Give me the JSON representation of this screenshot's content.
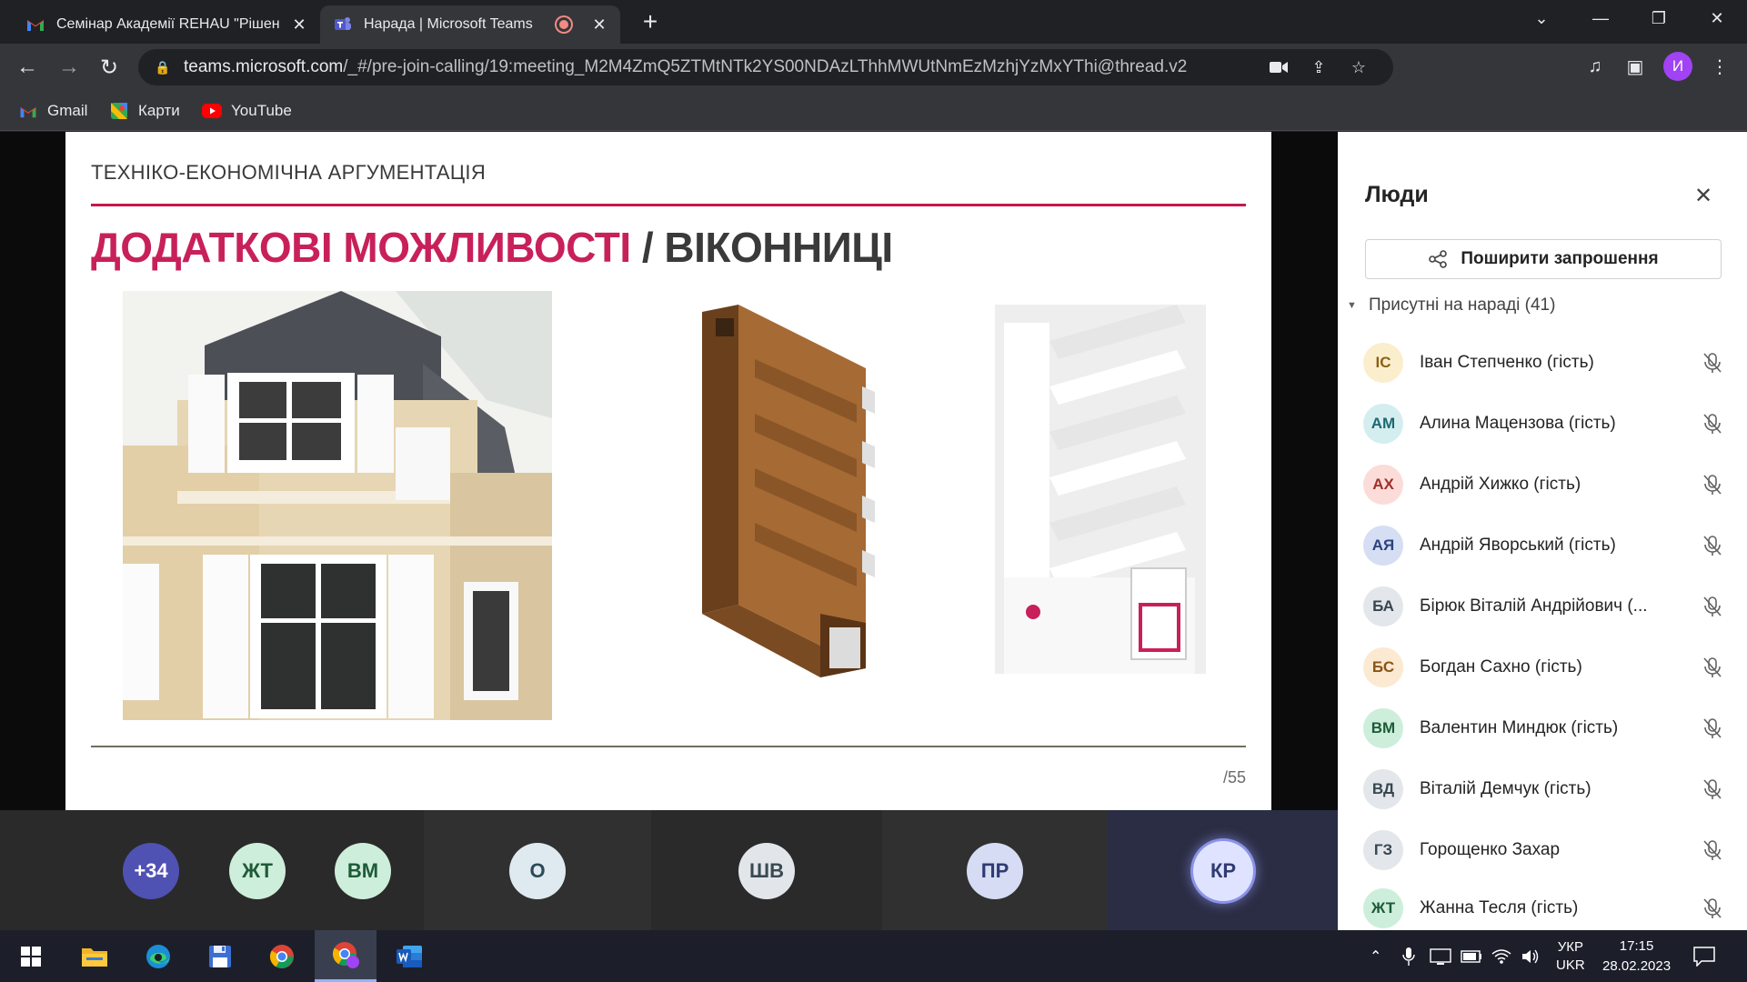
{
  "browser": {
    "tabs": [
      {
        "title": "Семінар Академії REHAU \"Рішен",
        "active": false,
        "icon": "gmail-icon"
      },
      {
        "title": "Нарада | Microsoft Teams",
        "active": true,
        "icon": "teams-icon",
        "recording": true
      }
    ],
    "address": {
      "host": "teams.microsoft.com",
      "path": "/_#/pre-join-calling/19:meeting_M2M4ZmQ5ZTMtNTk2YS00NDAzLThhMWUtNmEzMzhjYzMxYThi@thread.v2"
    },
    "bookmarks": [
      {
        "label": "Gmail",
        "icon": "gmail-icon"
      },
      {
        "label": "Карти",
        "icon": "maps-icon"
      },
      {
        "label": "YouTube",
        "icon": "youtube-icon"
      }
    ],
    "profile_initial": "И"
  },
  "slide": {
    "kicker": "ТЕХНІКО-ЕКОНОМІЧНА АРГУМЕНТАЦІЯ",
    "title_accent": "ДОДАТКОВІ МОЖЛИВОСТІ",
    "title_rest": " / ВІКОННИЦІ",
    "page_number": "/55",
    "accent_color": "#c8205a"
  },
  "tiles": [
    {
      "initials": "+34",
      "bg": "#4f52b2",
      "fg": "#ffffff"
    },
    {
      "initials": "ЖТ",
      "bg": "#cdeedb",
      "fg": "#1e5b38"
    },
    {
      "initials": "ВМ",
      "bg": "#cdeedb",
      "fg": "#1e5b38"
    },
    {
      "initials": "О",
      "bg": "#dfeaf0",
      "fg": "#2b4a5a"
    },
    {
      "initials": "ШВ",
      "bg": "#e2e6ea",
      "fg": "#3a4a55"
    },
    {
      "initials": "ПР",
      "bg": "#d5dcf3",
      "fg": "#2f3b72"
    },
    {
      "initials": "КР",
      "bg": "#dfe3ff",
      "fg": "#2f3b72"
    }
  ],
  "people": {
    "title": "Люди",
    "share_label": "Поширити запрошення",
    "section_label": "Присутні на нараді (41)",
    "participants": [
      {
        "initials": "ІС",
        "name": "Іван Степченко (гість)",
        "bg": "#fbeecd",
        "fg": "#8a6116"
      },
      {
        "initials": "АМ",
        "name": "Алина Мацензова (гість)",
        "bg": "#d4eef0",
        "fg": "#1c6a72"
      },
      {
        "initials": "АХ",
        "name": "Андрій Хижко (гість)",
        "bg": "#fbdcd8",
        "fg": "#a0302a"
      },
      {
        "initials": "АЯ",
        "name": "Андрій Яворський (гість)",
        "bg": "#d5def3",
        "fg": "#2b4380"
      },
      {
        "initials": "БА",
        "name": "Бірюк Віталій Андрійович (...",
        "bg": "#e3e6ea",
        "fg": "#37474f"
      },
      {
        "initials": "БС",
        "name": "Богдан Сахно (гість)",
        "bg": "#fbe9d2",
        "fg": "#8a5416"
      },
      {
        "initials": "ВМ",
        "name": "Валентин Миндюк (гість)",
        "bg": "#cdeedb",
        "fg": "#1e5b38"
      },
      {
        "initials": "ВД",
        "name": "Віталій Демчук (гість)",
        "bg": "#e3e6ea",
        "fg": "#37474f"
      },
      {
        "initials": "ГЗ",
        "name": "Горощенко Захар",
        "bg": "#e3e6ea",
        "fg": "#37474f"
      },
      {
        "initials": "ЖТ",
        "name": "Жанна Тесля (гість)",
        "bg": "#cdeedb",
        "fg": "#1e5b38"
      }
    ]
  },
  "taskbar": {
    "lang_top": "УКР",
    "lang_bottom": "UKR",
    "time": "17:15",
    "date": "28.02.2023"
  }
}
